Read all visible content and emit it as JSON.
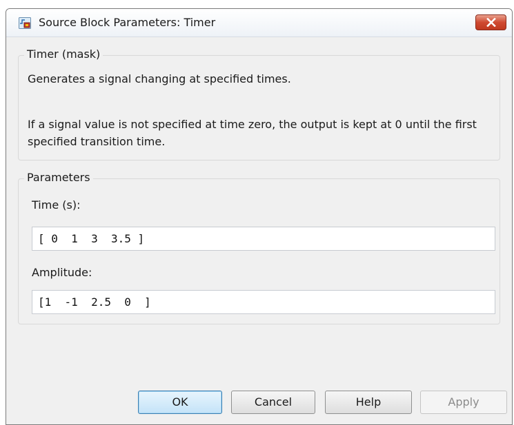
{
  "window": {
    "title": "Source Block Parameters: Timer",
    "close_icon": "close-icon",
    "app_icon": "simulink-block-icon"
  },
  "mask_group": {
    "legend": "Timer (mask)",
    "description_line1": "Generates a signal changing at specified times.",
    "description_line2": "If a signal value is not specified at time zero, the output is kept at 0 until the first specified transition time."
  },
  "parameters_group": {
    "legend": "Parameters",
    "time_label": "Time (s):",
    "time_value": "[ 0  1  3  3.5 ]",
    "amplitude_label": "Amplitude:",
    "amplitude_value": "[1  -1  2.5  0  ]"
  },
  "buttons": {
    "ok": "OK",
    "cancel": "Cancel",
    "help": "Help",
    "apply": "Apply"
  },
  "colors": {
    "close_button": "#cf4a31",
    "default_button_border": "#3c7fb1",
    "window_background": "#f0f0f0"
  }
}
